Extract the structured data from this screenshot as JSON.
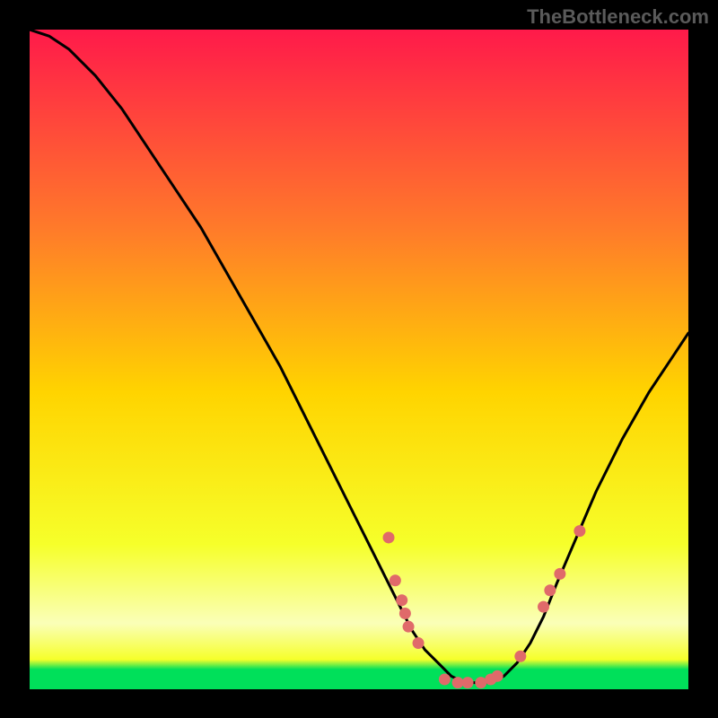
{
  "watermark": "TheBottleneck.com",
  "colors": {
    "gradient_top": "#ff1a4a",
    "gradient_mid_upper": "#ff7a2a",
    "gradient_mid": "#ffd400",
    "gradient_lower": "#f6ff2a",
    "gradient_band_pale": "#faffb8",
    "gradient_bottom": "#00e05a",
    "curve": "#000000",
    "markers": "#e06a6a"
  },
  "chart_data": {
    "type": "line",
    "title": "",
    "xlabel": "",
    "ylabel": "",
    "xlim": [
      0,
      100
    ],
    "ylim": [
      0,
      100
    ],
    "series": [
      {
        "name": "bottleneck-curve",
        "x": [
          0,
          3,
          6,
          10,
          14,
          18,
          22,
          26,
          30,
          34,
          38,
          42,
          46,
          50,
          53,
          56,
          58,
          60,
          62,
          64,
          66,
          68,
          70,
          72,
          74,
          76,
          78,
          80,
          83,
          86,
          90,
          94,
          98,
          100
        ],
        "y": [
          100,
          99,
          97,
          93,
          88,
          82,
          76,
          70,
          63,
          56,
          49,
          41,
          33,
          25,
          19,
          13,
          9,
          6,
          4,
          2,
          1,
          1,
          1,
          2,
          4,
          7,
          11,
          16,
          23,
          30,
          38,
          45,
          51,
          54
        ]
      }
    ],
    "markers": [
      {
        "x": 54.5,
        "y": 23.0
      },
      {
        "x": 55.5,
        "y": 16.5
      },
      {
        "x": 56.5,
        "y": 13.5
      },
      {
        "x": 57.0,
        "y": 11.5
      },
      {
        "x": 57.5,
        "y": 9.5
      },
      {
        "x": 59.0,
        "y": 7.0
      },
      {
        "x": 63.0,
        "y": 1.5
      },
      {
        "x": 65.0,
        "y": 1.0
      },
      {
        "x": 66.5,
        "y": 1.0
      },
      {
        "x": 68.5,
        "y": 1.0
      },
      {
        "x": 70.0,
        "y": 1.5
      },
      {
        "x": 71.0,
        "y": 2.0
      },
      {
        "x": 74.5,
        "y": 5.0
      },
      {
        "x": 78.0,
        "y": 12.5
      },
      {
        "x": 79.0,
        "y": 15.0
      },
      {
        "x": 80.5,
        "y": 17.5
      },
      {
        "x": 83.5,
        "y": 24.0
      }
    ],
    "marker_radius_px": 6.5,
    "gradient_stops": [
      {
        "offset": 0.0,
        "key": "gradient_top"
      },
      {
        "offset": 0.3,
        "key": "gradient_mid_upper"
      },
      {
        "offset": 0.55,
        "key": "gradient_mid"
      },
      {
        "offset": 0.78,
        "key": "gradient_lower"
      },
      {
        "offset": 0.9,
        "key": "gradient_band_pale"
      },
      {
        "offset": 0.955,
        "key": "gradient_lower"
      },
      {
        "offset": 0.97,
        "key": "gradient_bottom"
      },
      {
        "offset": 1.0,
        "key": "gradient_bottom"
      }
    ]
  }
}
